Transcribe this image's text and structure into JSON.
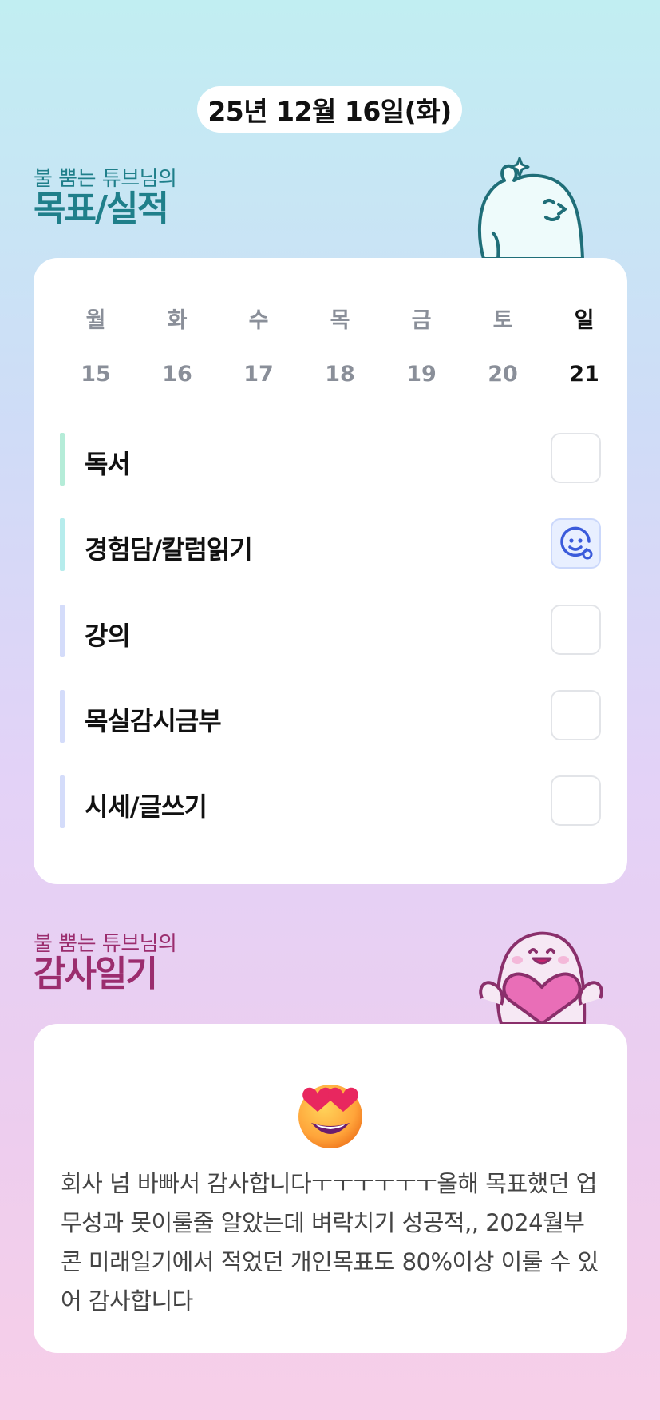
{
  "header": {
    "date": "25년 12월 16일(화)"
  },
  "goal_section": {
    "subtitle": "불 뿜는 튜브님의",
    "title": "목표/실적"
  },
  "week": {
    "days": [
      "월",
      "화",
      "수",
      "목",
      "금",
      "토",
      "일"
    ],
    "dates": [
      "15",
      "16",
      "17",
      "18",
      "19",
      "20",
      "21"
    ],
    "active_index": 6
  },
  "goals": [
    {
      "label": "독서",
      "checked": false,
      "bar_color": "#b5ecd8"
    },
    {
      "label": "경험담/칼럼읽기",
      "checked": true,
      "bar_color": "#b6ecec",
      "check_icon": "smile-icon"
    },
    {
      "label": "강의",
      "checked": false,
      "bar_color": "#d4dcfa"
    },
    {
      "label": "목실감시금부",
      "checked": false,
      "bar_color": "#d4dcfa"
    },
    {
      "label": "시세/글쓰기",
      "checked": false,
      "bar_color": "#d4dcfa"
    }
  ],
  "thanks_section": {
    "subtitle": "불 뿜는 튜브님의",
    "title": "감사일기"
  },
  "diary": {
    "emoji": "heart-eyes-emoji",
    "text": "회사 넘 바빠서 감사합니다ㅜㅜㅜㅜㅜㅜ올해 목표했던 업무성과 못이룰줄 알았는데 벼락치기 성공적,, 2024월부콘 미래일기에서 적었던 개인목표도 80%이상 이룰 수 있어 감사합니다"
  },
  "colors": {
    "goal_title": "#1f7f8a",
    "thanks_title": "#9b2d6e",
    "check_active": "#3b5bdb"
  }
}
